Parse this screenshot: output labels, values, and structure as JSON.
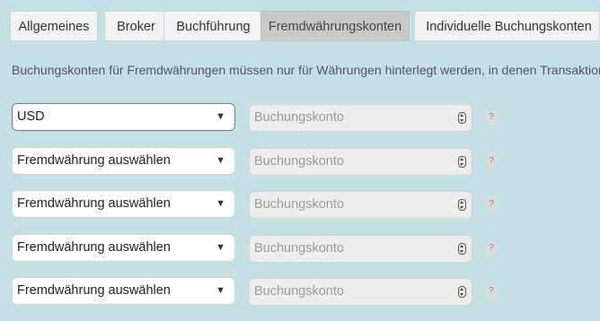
{
  "tabs": [
    {
      "label": "Allgemeines",
      "active": false
    },
    {
      "label": "Broker",
      "active": false
    },
    {
      "label": "Buchführung",
      "active": false
    },
    {
      "label": "Fremdwährungskonten",
      "active": true
    },
    {
      "label": "Individuelle Buchungskonten",
      "active": false
    }
  ],
  "info_text": "Buchungskonten für Fremdwährungen müssen nur für Währungen hinterlegt werden, in denen Transaktionen",
  "rows": [
    {
      "currency": "USD",
      "account_placeholder": "Buchungskonto",
      "help": "?"
    },
    {
      "currency": "Fremdwährung auswählen",
      "account_placeholder": "Buchungskonto",
      "help": "?"
    },
    {
      "currency": "Fremdwährung auswählen",
      "account_placeholder": "Buchungskonto",
      "help": "?"
    },
    {
      "currency": "Fremdwährung auswählen",
      "account_placeholder": "Buchungskonto",
      "help": "?"
    },
    {
      "currency": "Fremdwährung auswählen",
      "account_placeholder": "Buchungskonto",
      "help": "?"
    }
  ],
  "icons": {
    "select_arrow": "▼",
    "number_spinner": "spinner-icon",
    "help": "help-icon"
  },
  "colors": {
    "background": "#c5e0e5",
    "active_tab": "#c9c9c9",
    "inactive_tab": "#f1f2f3",
    "account_field": "#ededed"
  }
}
